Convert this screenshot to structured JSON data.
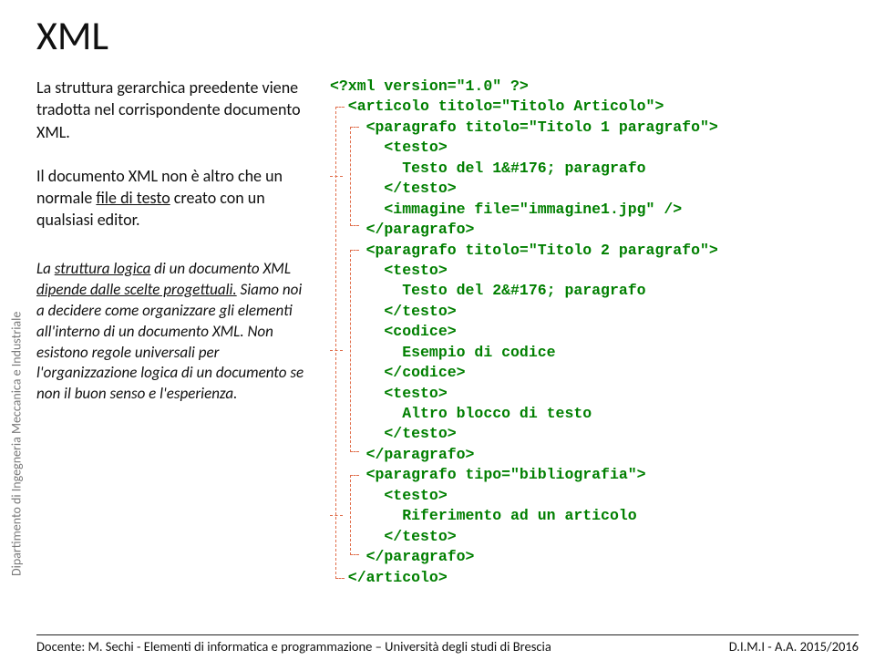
{
  "sidebar": {
    "label": "Dipartimento di Ingegneria Meccanica e Industriale"
  },
  "title": "XML",
  "left": {
    "p1_a": "La struttura gerarchica preedente viene tradotta nel corrispondente documento XML.",
    "p2_a": "Il documento XML non è altro che un normale ",
    "p2_u": "file di testo",
    "p2_b": " creato con un qualsiasi editor.",
    "p3_a": "La ",
    "p3_u1": "struttura logica",
    "p3_b": " di un documento XML ",
    "p3_u2": "dipende dalle scelte progettuali.",
    "p3_c": " Siamo noi a decidere come organizzare gli elementi all'interno di un documento XML. Non esistono regole universali per l'organizzazione logica di un documento se non il buon senso e l'esperienza."
  },
  "code": "<?xml version=\"1.0\" ?>\n  <articolo titolo=\"Titolo Articolo\">\n    <paragrafo titolo=\"Titolo 1 paragrafo\">\n      <testo>\n        Testo del 1&#176; paragrafo\n      </testo>\n      <immagine file=\"immagine1.jpg\" />\n    </paragrafo>\n    <paragrafo titolo=\"Titolo 2 paragrafo\">\n      <testo>\n        Testo del 2&#176; paragrafo\n      </testo>\n      <codice>\n        Esempio di codice\n      </codice>\n      <testo>\n        Altro blocco di testo\n      </testo>\n    </paragrafo>\n    <paragrafo tipo=\"bibliografia\">\n      <testo>\n        Riferimento ad un articolo\n      </testo>\n    </paragrafo>\n  </articolo>",
  "footer": {
    "left": "Docente: M. Sechi  - Elementi di informatica e programmazione – Università degli studi di Brescia",
    "right": "D.I.M.I - A.A. 2015/2016"
  }
}
